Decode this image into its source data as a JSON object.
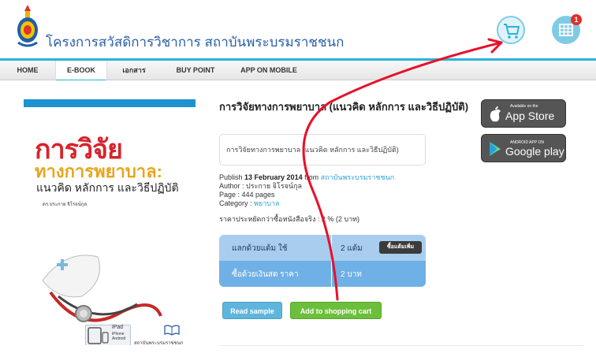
{
  "header": {
    "site_title": "โครงการสวัสดิการวิชาการ สถาบันพระบรมราชชนก",
    "cart_badge": "1"
  },
  "nav": {
    "items": [
      "HOME",
      "E-BOOK",
      "เอกสาร",
      "BUY POINT",
      "APP ON MOBILE"
    ],
    "active": "E-BOOK"
  },
  "cover": {
    "title_line1": "การวิจัย",
    "title_line2": "ทางการพยาบาล:",
    "subtitle": "แนวคิด หลักการ และวิธีปฏิบัติ",
    "author": "ดร.ประกาย จิโรจน์กุล",
    "device_ipad": "iPad",
    "device_iphone": "iPhone",
    "device_android": "Android",
    "publisher": "สถาบันพระบรมราชชนก"
  },
  "book": {
    "title": "การวิจัยทางการพยาบาล (แนวคิด หลักการ และวิธีปฏิบัติ)",
    "description": "การวิจัยทางการพยาบาล (แนวคิด หลักการ และวิธีปฏิบัติ)",
    "publish_prefix": "Publish ",
    "publish_date": "13 February 2014",
    "publish_from": " from ",
    "publisher": "สถาบันพระบรมราชชนก",
    "author_line": "Author : ประกาย จิโรจน์กุล",
    "page_line": "Page : 444 pages",
    "category_prefix": "Category : ",
    "category": "พยาบาล",
    "discount_line": "ราคาประหยัดกว่าซื้อหนังสือจริง : 2 % (2 บาท)"
  },
  "pricing": {
    "row1_label": "แลกด้วยแต้ม ใช้",
    "row1_value": "2 แต้ม",
    "row1_button": "ซื้อแต้มเพิ่ม",
    "row2_label": "ซื้อด้วยเงินสด ราคา",
    "row2_value": "2 บาท"
  },
  "actions": {
    "read_sample": "Read sample",
    "add_to_cart": "Add to shopping cart"
  },
  "stores": {
    "appstore_small": "Available on the",
    "appstore_big": "App Store",
    "googleplay_small": "ANDROID APP ON",
    "googleplay_big": "Google play"
  },
  "colors": {
    "accent": "#2bb3d6",
    "link": "#2ea0d6",
    "annotation": "#e8102a",
    "cart_button": "#6cbf3b"
  }
}
